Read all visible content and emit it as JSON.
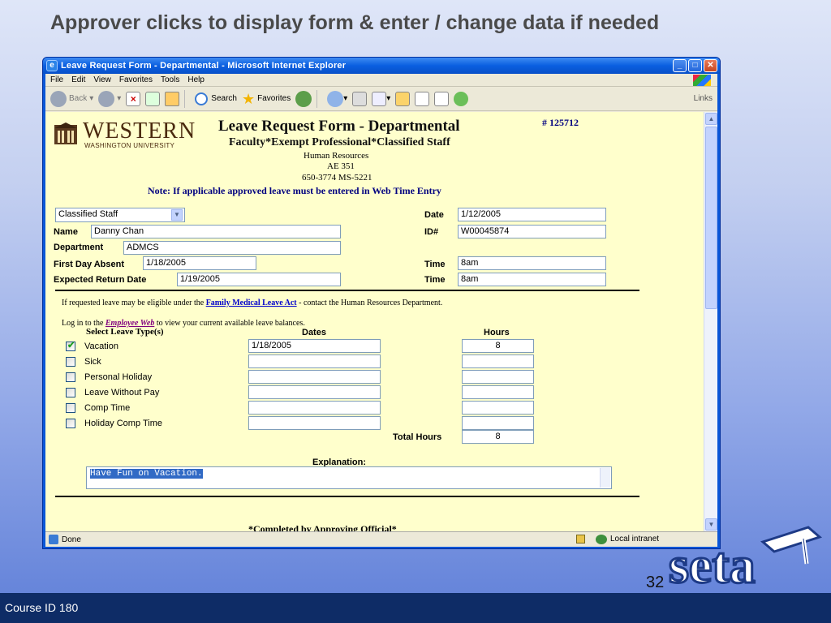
{
  "slide": {
    "title": "Approver clicks to display form & enter / change data if needed",
    "footer": "Course ID 180",
    "page_number": "32",
    "logo_text": "seta"
  },
  "window": {
    "title": "Leave Request Form - Departmental - Microsoft Internet Explorer",
    "menu": [
      "File",
      "Edit",
      "View",
      "Favorites",
      "Tools",
      "Help"
    ],
    "toolbar": {
      "back": "Back",
      "search": "Search",
      "favorites": "Favorites",
      "links": "Links"
    }
  },
  "form": {
    "org_name": "WESTERN",
    "org_sub": "WASHINGTON UNIVERSITY",
    "title": "Leave Request Form - Departmental",
    "number": "# 125712",
    "subtitle": "Faculty*Exempt Professional*Classified Staff",
    "dept_line1": "Human Resources",
    "dept_line2": "AE 351",
    "dept_line3": "650-3774 MS-5221",
    "note": "Note: If applicable approved leave must be entered in Web Time Entry",
    "staff_type": "Classified Staff",
    "labels": {
      "date": "Date",
      "name": "Name",
      "id": "ID#",
      "department": "Department",
      "first_day": "First Day Absent",
      "time": "Time",
      "return_date": "Expected Return Date"
    },
    "values": {
      "date": "1/12/2005",
      "name": "Danny Chan",
      "id": "W00045874",
      "department": "ADMCS",
      "first_day": "1/18/2005",
      "first_time": "8am",
      "return_date": "1/19/2005",
      "return_time": "8am"
    },
    "fmla_pre": "If requested leave may be eligible under the",
    "fmla_link": "Family Medical Leave Act",
    "fmla_post": "- contact the Human Resources Department.",
    "login_pre": "Log in to the",
    "login_link": "Employee Web",
    "login_post": "to view your current available leave balances.",
    "col_leave": "Select Leave Type(s)",
    "col_dates": "Dates",
    "col_hours": "Hours",
    "leave_types": [
      {
        "label": "Vacation",
        "checked": true,
        "dates": "1/18/2005",
        "hours": "8"
      },
      {
        "label": "Sick",
        "checked": false,
        "dates": "",
        "hours": ""
      },
      {
        "label": "Personal Holiday",
        "checked": false,
        "dates": "",
        "hours": ""
      },
      {
        "label": "Leave Without Pay",
        "checked": false,
        "dates": "",
        "hours": ""
      },
      {
        "label": "Comp Time",
        "checked": false,
        "dates": "",
        "hours": ""
      },
      {
        "label": "Holiday Comp Time",
        "checked": false,
        "dates": "",
        "hours": ""
      }
    ],
    "total_label": "Total Hours",
    "total_value": "8",
    "explanation_label": "Explanation:",
    "explanation_value": "Have Fun on Vacation.",
    "completed_label": "*Completed by Approving Official*"
  },
  "status": {
    "left": "Done",
    "zone": "Local intranet"
  }
}
